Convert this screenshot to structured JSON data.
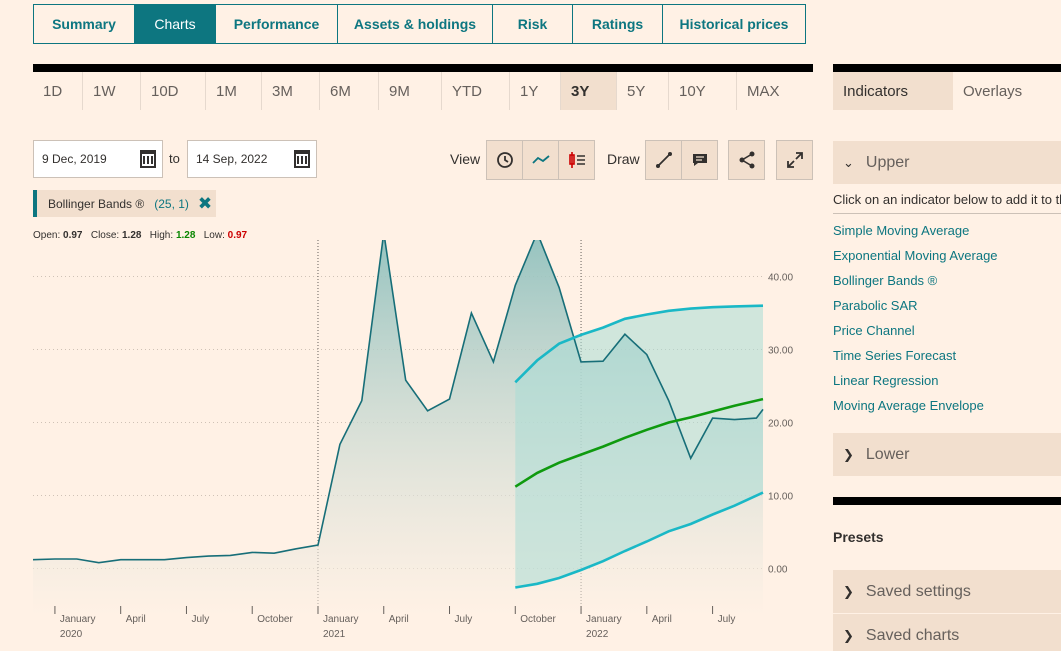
{
  "tabs": [
    "Summary",
    "Charts",
    "Performance",
    "Assets & holdings",
    "Risk",
    "Ratings",
    "Historical prices"
  ],
  "active_tab": "Charts",
  "ranges": [
    "1D",
    "1W",
    "10D",
    "1M",
    "3M",
    "6M",
    "9M",
    "YTD",
    "1Y",
    "3Y",
    "5Y",
    "10Y",
    "MAX"
  ],
  "active_range": "3Y",
  "date_from": "9 Dec, 2019",
  "to_label": "to",
  "date_to": "14 Sep, 2022",
  "view_label": "View",
  "draw_label": "Draw",
  "indicator_chip": {
    "name": "Bollinger Bands ®",
    "params": "(25, 1)",
    "remove": "✖"
  },
  "ohlc": {
    "open_label": "Open:",
    "open": "0.97",
    "close_label": "Close:",
    "close": "1.28",
    "high_label": "High:",
    "high": "1.28",
    "low_label": "Low:",
    "low": "0.97"
  },
  "right_panel": {
    "tabs": [
      "Indicators",
      "Overlays"
    ],
    "upper": "Upper",
    "hint": "Click on an indicator below to add it to the chart",
    "indicators": [
      "Simple Moving Average",
      "Exponential Moving Average",
      "Bollinger Bands ®",
      "Parabolic SAR",
      "Price Channel",
      "Time Series Forecast",
      "Linear Regression",
      "Moving Average Envelope"
    ],
    "lower": "Lower",
    "presets": "Presets",
    "saved_settings": "Saved settings",
    "saved_charts": "Saved charts"
  },
  "colors": {
    "accent": "#0d7680",
    "band": "#1ab8c6",
    "middle": "#0f9a0f",
    "price": "#176e78"
  },
  "chart_data": {
    "type": "area",
    "y_ticks": [
      "40.00",
      "30.00",
      "20.00",
      "10.00",
      "0.00"
    ],
    "ylim": [
      -5,
      45
    ],
    "x_month_labels": [
      {
        "t": 0.3,
        "label": "January",
        "year": "2020"
      },
      {
        "t": 3.3,
        "label": "April",
        "year": ""
      },
      {
        "t": 6.3,
        "label": "July",
        "year": ""
      },
      {
        "t": 9.3,
        "label": "October",
        "year": ""
      },
      {
        "t": 12.3,
        "label": "January",
        "year": "2021"
      },
      {
        "t": 15.3,
        "label": "April",
        "year": ""
      },
      {
        "t": 18.3,
        "label": "July",
        "year": ""
      },
      {
        "t": 21.3,
        "label": "October",
        "year": ""
      },
      {
        "t": 24.3,
        "label": "January",
        "year": "2022"
      },
      {
        "t": 27.3,
        "label": "April",
        "year": ""
      },
      {
        "t": 30.3,
        "label": "July",
        "year": ""
      }
    ],
    "year_dividers": [
      12.3,
      24.3
    ],
    "xlim": [
      -0.7,
      32.6
    ],
    "price": {
      "t": [
        -0.7,
        0.3,
        1.3,
        2.3,
        3.3,
        4.3,
        5.3,
        6.3,
        7.3,
        8.3,
        9.3,
        10.3,
        11.3,
        12.3,
        13.3,
        14.3,
        15.3,
        16.3,
        17.3,
        18.3,
        19.3,
        20.3,
        21.3,
        22.3,
        23.3,
        24.3,
        25.3,
        26.3,
        27.3,
        28.3,
        29.3,
        30.3,
        31.3,
        32.3,
        32.6
      ],
      "v": [
        1.2,
        1.3,
        1.3,
        0.8,
        1.2,
        1.2,
        1.2,
        1.5,
        1.7,
        1.8,
        2.2,
        2.1,
        2.7,
        3.2,
        17.0,
        23.0,
        46.0,
        25.8,
        21.6,
        23.2,
        35.0,
        28.3,
        38.8,
        46.0,
        38.5,
        28.3,
        28.4,
        32.1,
        29.3,
        23.0,
        15.1,
        20.6,
        20.4,
        20.6,
        21.8
      ]
    },
    "bollinger": {
      "t": [
        21.3,
        22.3,
        23.3,
        24.3,
        25.3,
        26.3,
        27.3,
        28.3,
        29.3,
        30.3,
        31.3,
        32.6
      ],
      "upper": [
        25.5,
        28.5,
        30.8,
        32.0,
        33.0,
        34.2,
        34.8,
        35.3,
        35.6,
        35.8,
        35.9,
        36.0
      ],
      "middle": [
        11.2,
        13.1,
        14.5,
        15.6,
        16.7,
        17.9,
        19.0,
        20.0,
        20.7,
        21.5,
        22.3,
        23.2
      ],
      "lower": [
        -2.6,
        -2.1,
        -1.3,
        -0.2,
        1.0,
        2.4,
        3.7,
        5.1,
        6.1,
        7.4,
        8.6,
        10.4
      ]
    }
  }
}
